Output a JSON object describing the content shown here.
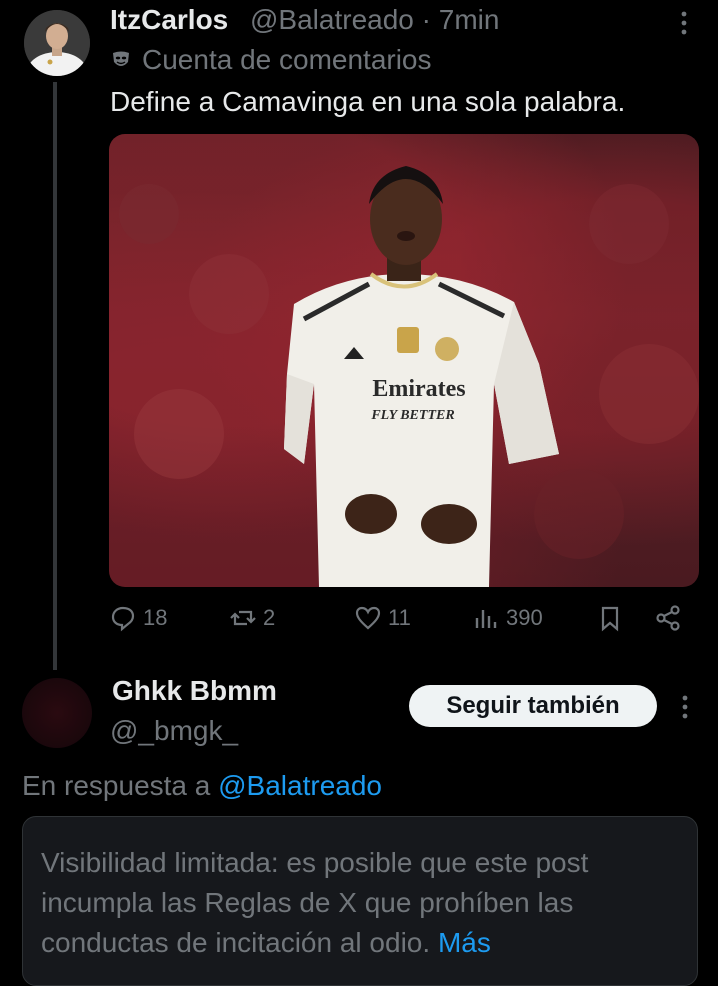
{
  "post": {
    "author_name": "ItzCarlos",
    "handle_time": "@Balatreado · 7min",
    "account_label": "Cuenta de comentarios",
    "text": "Define a Camavinga en una sola palabra.",
    "photo_caption": {
      "sponsor": "Emirates",
      "sponsor_tag": "FLY BETTER"
    },
    "metrics": {
      "replies": "18",
      "reposts": "2",
      "likes": "11",
      "views": "390"
    }
  },
  "reply": {
    "author_name": "Ghkk Bbmm",
    "handle": "@_bmgk_",
    "follow_label": "Seguir también",
    "in_reply_prefix": "En respuesta a",
    "in_reply_mention": "@Balatreado",
    "notice_text": "Visibilidad limitada: es posible que este post incumpla las Reglas de X que prohíben las conductas de incitación al odio.",
    "notice_more": "Más"
  },
  "colors": {
    "background": "#000000",
    "text_primary": "#e7e9ea",
    "text_secondary": "#71767b",
    "link": "#1d9bf0",
    "card_bg": "#16181c"
  },
  "icons": [
    "more-icon",
    "comment-account-icon",
    "reply-icon",
    "repost-icon",
    "like-icon",
    "views-icon",
    "bookmark-icon",
    "share-icon"
  ]
}
